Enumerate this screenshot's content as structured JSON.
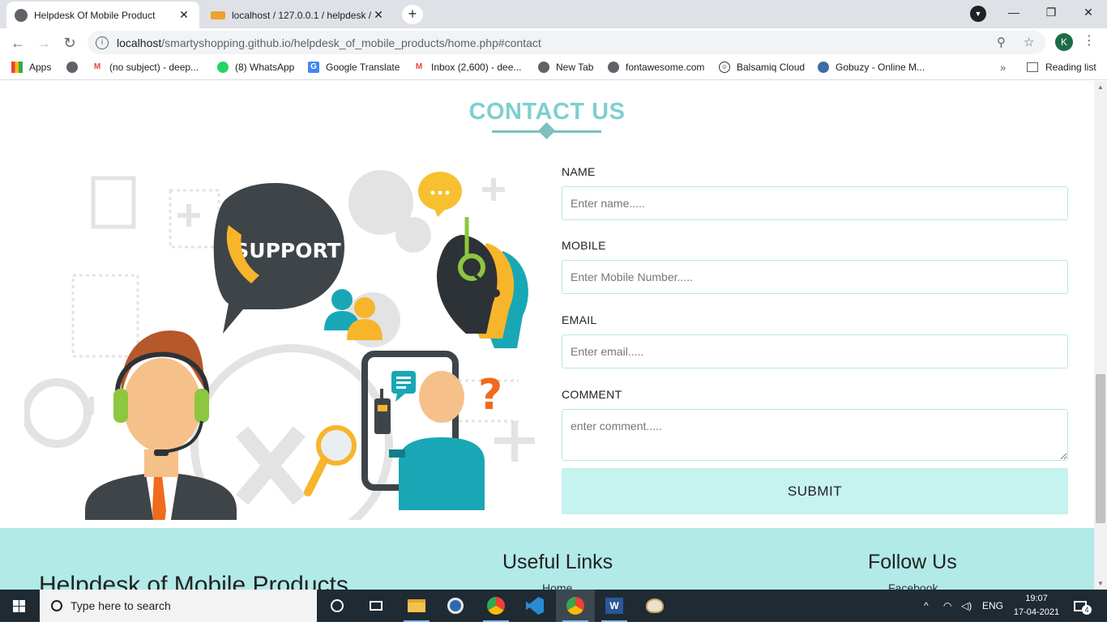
{
  "browser": {
    "tabs": [
      {
        "title": "Helpdesk Of Mobile Product",
        "active": true
      },
      {
        "title": "localhost / 127.0.0.1 / helpdesk /",
        "active": false
      }
    ],
    "new_tab": "+",
    "url": {
      "host": "localhost",
      "path": "/smartyshopping.github.io/helpdesk_of_mobile_products/home.php#contact"
    },
    "profile_initial": "K",
    "bookmarks": [
      "Apps",
      "(no subject) - deep...",
      "(8) WhatsApp",
      "Google Translate",
      "Inbox (2,600) - dee...",
      "New Tab",
      "fontawesome.com",
      "Balsamiq Cloud",
      "Gobuzy - Online M..."
    ],
    "bookmarks_more": "»",
    "reading_list": "Reading list"
  },
  "contact": {
    "title": "CONTACT US",
    "illustration_text": "SUPPORT",
    "form": {
      "name_label": "NAME",
      "name_placeholder": "Enter name.....",
      "mobile_label": "MOBILE",
      "mobile_placeholder": "Enter Mobile Number.....",
      "email_label": "EMAIL",
      "email_placeholder": "Enter email.....",
      "comment_label": "COMMENT",
      "comment_placeholder": "enter comment.....",
      "submit_label": "SUBMIT"
    }
  },
  "footer": {
    "brand": "Helpdesk of Mobile Products",
    "useful_links_title": "Useful Links",
    "useful_links_first": "Home",
    "follow_title": "Follow Us",
    "follow_first": "Facebook"
  },
  "taskbar": {
    "search_placeholder": "Type here to search",
    "language": "ENG",
    "time": "19:07",
    "date": "17-04-2021",
    "notification_count": "4"
  },
  "colors": {
    "accent_teal": "#7fcfcf",
    "footer_bg": "#b2eae8",
    "submit_bg": "#c6f2ef"
  }
}
